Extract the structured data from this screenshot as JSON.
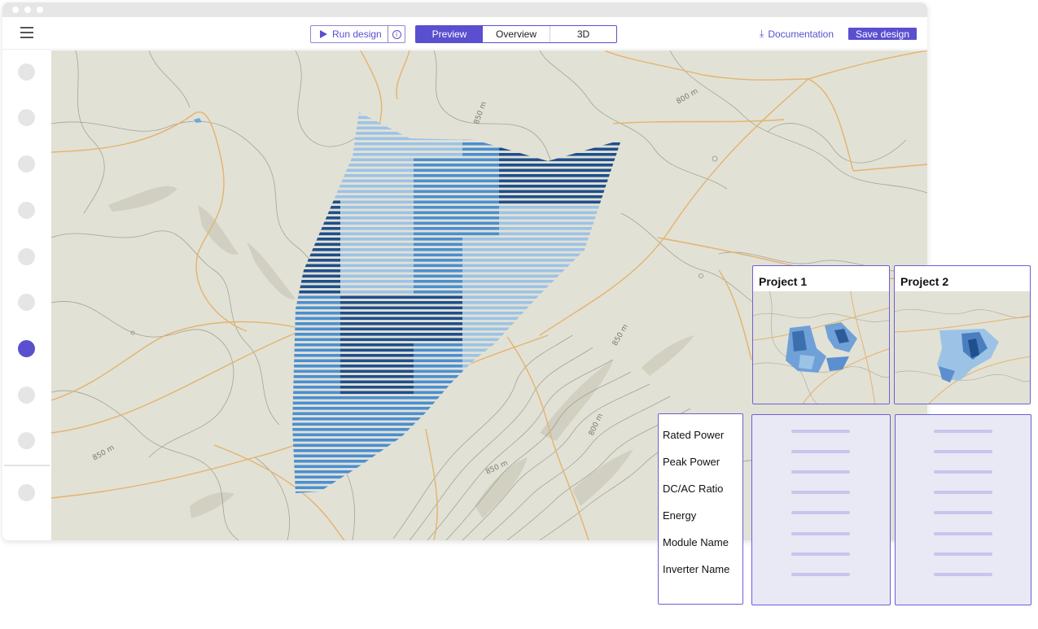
{
  "toolbar": {
    "menu_icon": "hamburger-icon",
    "run_label": "Run design",
    "run_icon": "play-icon",
    "info_icon": "info-icon",
    "info_glyph": "i",
    "tabs": [
      {
        "label": "Preview",
        "active": true
      },
      {
        "label": "Overview",
        "active": false
      },
      {
        "label": "3D",
        "active": false
      }
    ],
    "docs_label": "Documentation",
    "docs_icon": "download-icon",
    "save_label": "Save design"
  },
  "sidebar": {
    "item_count": 10,
    "active_index": 6
  },
  "map": {
    "contour_labels": [
      "800 m",
      "850 m",
      "850 m",
      "800 m",
      "850 m",
      "850 m"
    ]
  },
  "comparison": {
    "projects": [
      {
        "title": "Project 1"
      },
      {
        "title": "Project 2"
      }
    ],
    "metrics": [
      "Rated Power",
      "Peak Power",
      "DC/AC Ratio",
      "Energy",
      "Module Name",
      "Inverter Name"
    ]
  },
  "colors": {
    "accent": "#5a4fcf",
    "map_background": "#e2e1d5",
    "road": "#e8b46a",
    "array_light": "#9cc3e6",
    "array_mid": "#4a8fd1",
    "array_dark": "#1f4f8c"
  }
}
